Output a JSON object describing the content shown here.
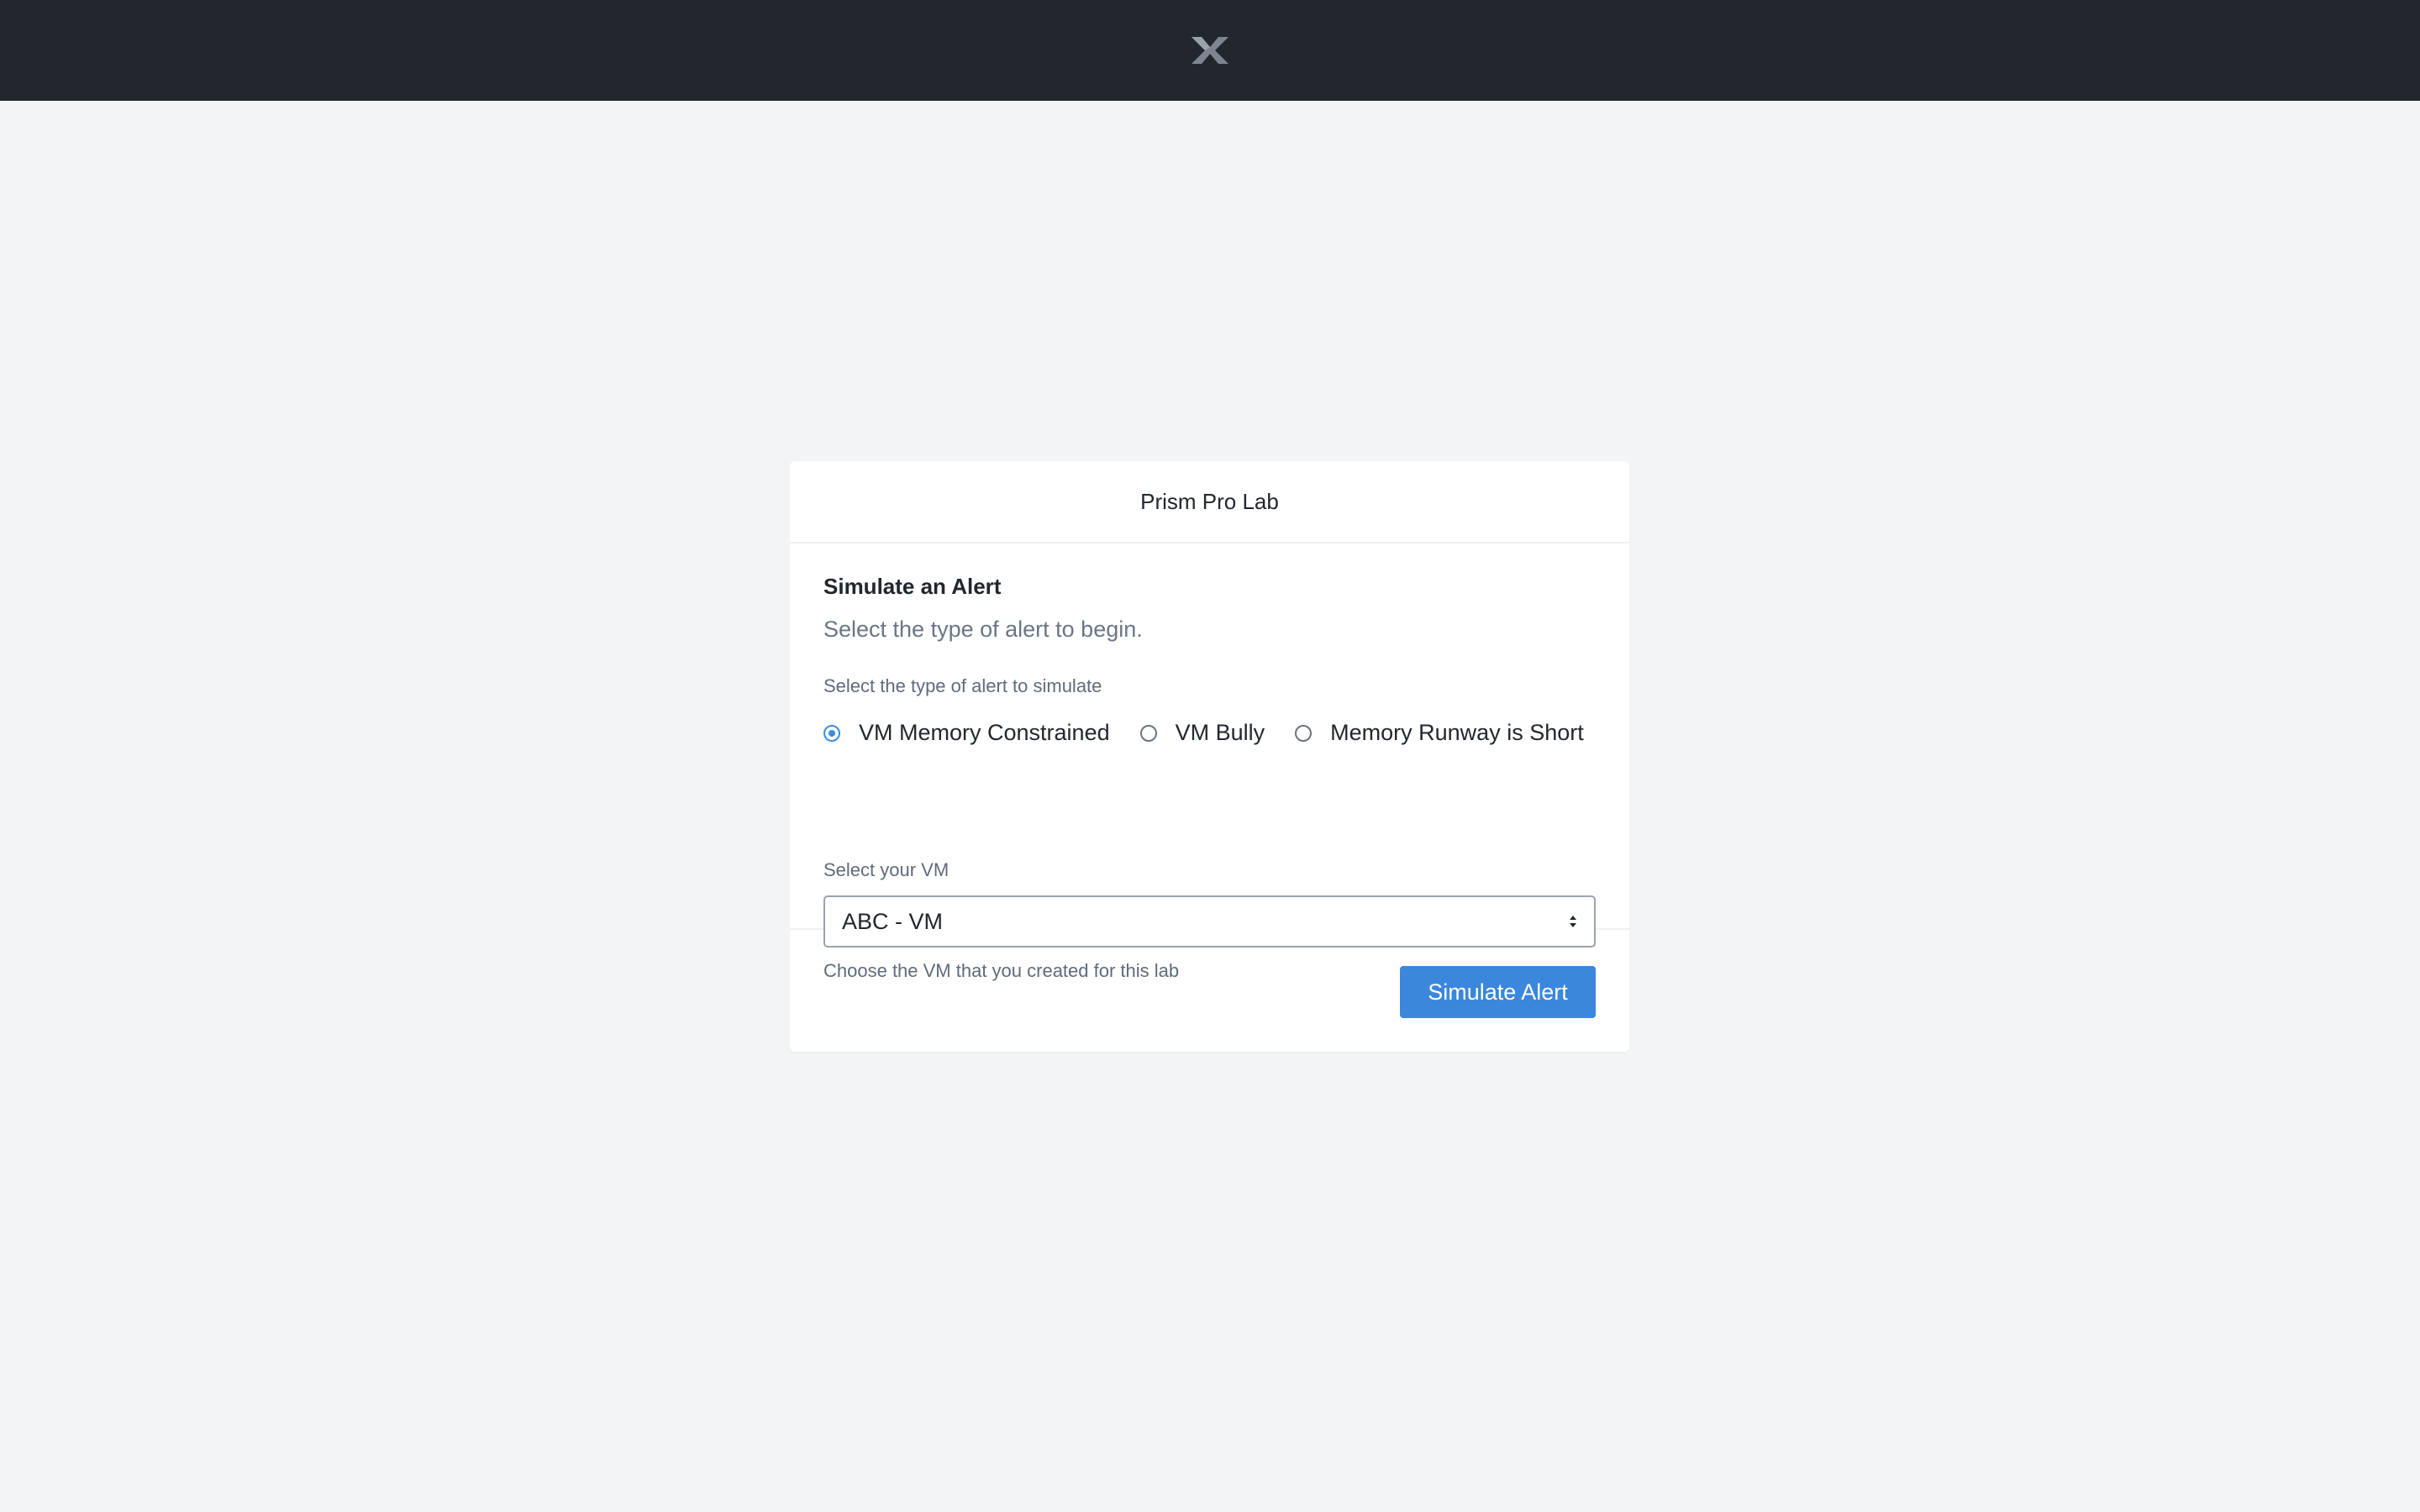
{
  "header": {
    "logo_icon": "nutanix-x-logo-icon"
  },
  "card": {
    "title": "Prism Pro Lab",
    "section_title": "Simulate an Alert",
    "section_subtitle": "Select the type of alert to begin.",
    "alert_type_label": "Select the type of alert to simulate",
    "alert_types": [
      {
        "label": "VM Memory Constrained",
        "selected": true
      },
      {
        "label": "VM Bully",
        "selected": false
      },
      {
        "label": "Memory Runway is Short",
        "selected": false
      }
    ],
    "vm_label": "Select your VM",
    "vm_selected": "ABC - VM",
    "vm_helper": "Choose the VM that you created for this lab",
    "submit_label": "Simulate Alert"
  },
  "colors": {
    "topbar": "#22272e",
    "background": "#f2f4f6",
    "accent": "#3a87db"
  }
}
